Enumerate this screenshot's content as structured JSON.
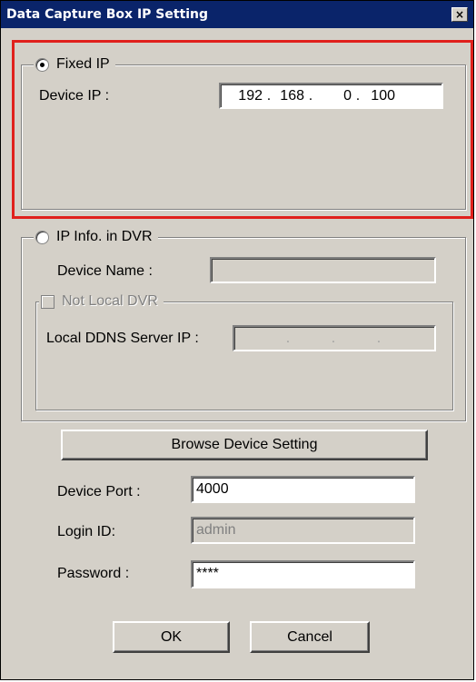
{
  "window": {
    "title": "Data Capture Box IP Setting",
    "close_symbol": "×"
  },
  "fixed_ip": {
    "label": "Fixed IP",
    "selected": true,
    "device_ip_label": "Device IP :",
    "ip": [
      "192",
      "168",
      "0",
      "100"
    ],
    "separator": "."
  },
  "dvr_info": {
    "label": "IP Info. in DVR",
    "selected": false,
    "device_name_label": "Device Name :",
    "device_name_value": "",
    "not_local": {
      "label": "Not Local DVR",
      "checked": false,
      "ddns_label": "Local DDNS Server IP :",
      "ddns_ip": [
        "",
        "",
        "",
        ""
      ],
      "separator": "."
    }
  },
  "browse_button": "Browse Device Setting",
  "device_port": {
    "label": "Device Port :",
    "value": "4000"
  },
  "login_id": {
    "label": "Login ID:",
    "value": "admin"
  },
  "password": {
    "label": "Password :",
    "value": "****"
  },
  "buttons": {
    "ok": "OK",
    "cancel": "Cancel"
  },
  "colors": {
    "titlebar": "#0a246a",
    "dialog_bg": "#d4d0c8",
    "highlight": "#e0201c"
  }
}
